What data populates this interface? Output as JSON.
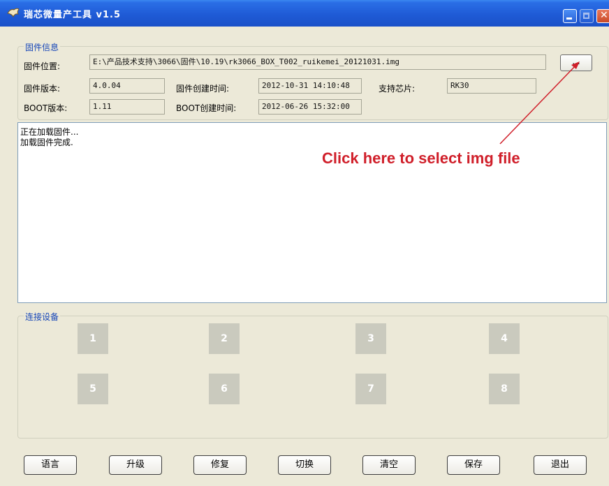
{
  "window": {
    "title": "瑞芯微量产工具  v1.5"
  },
  "firmware": {
    "group_label": "固件信息",
    "path_label": "固件位置:",
    "path_value": "E:\\产品技术支持\\3066\\固件\\10.19\\rk3066_BOX_T002_ruikemei_20121031.img",
    "browse_label": "...",
    "version_label": "固件版本:",
    "version_value": "4.0.04",
    "created_label": "固件创建时间:",
    "created_value": "2012-10-31 14:10:48",
    "chip_label": "支持芯片:",
    "chip_value": "RK30",
    "boot_version_label": "BOOT版本:",
    "boot_version_value": "1.11",
    "boot_created_label": "BOOT创建时间:",
    "boot_created_value": "2012-06-26 15:32:00"
  },
  "log": {
    "lines": [
      "正在加载固件...",
      "加载固件完成."
    ]
  },
  "annotation": {
    "text": "Click here to select img file",
    "color": "#d01f2a"
  },
  "devices": {
    "group_label": "连接设备",
    "slots": [
      "1",
      "2",
      "3",
      "4",
      "5",
      "6",
      "7",
      "8"
    ]
  },
  "buttons": {
    "language": "语言",
    "upgrade": "升级",
    "repair": "修复",
    "switch": "切换",
    "clear": "清空",
    "save": "保存",
    "exit": "退出"
  },
  "icons": {
    "app": "rockchip-app-icon",
    "minimize": "minimize-icon",
    "maximize": "maximize-icon",
    "close": "close-icon"
  }
}
